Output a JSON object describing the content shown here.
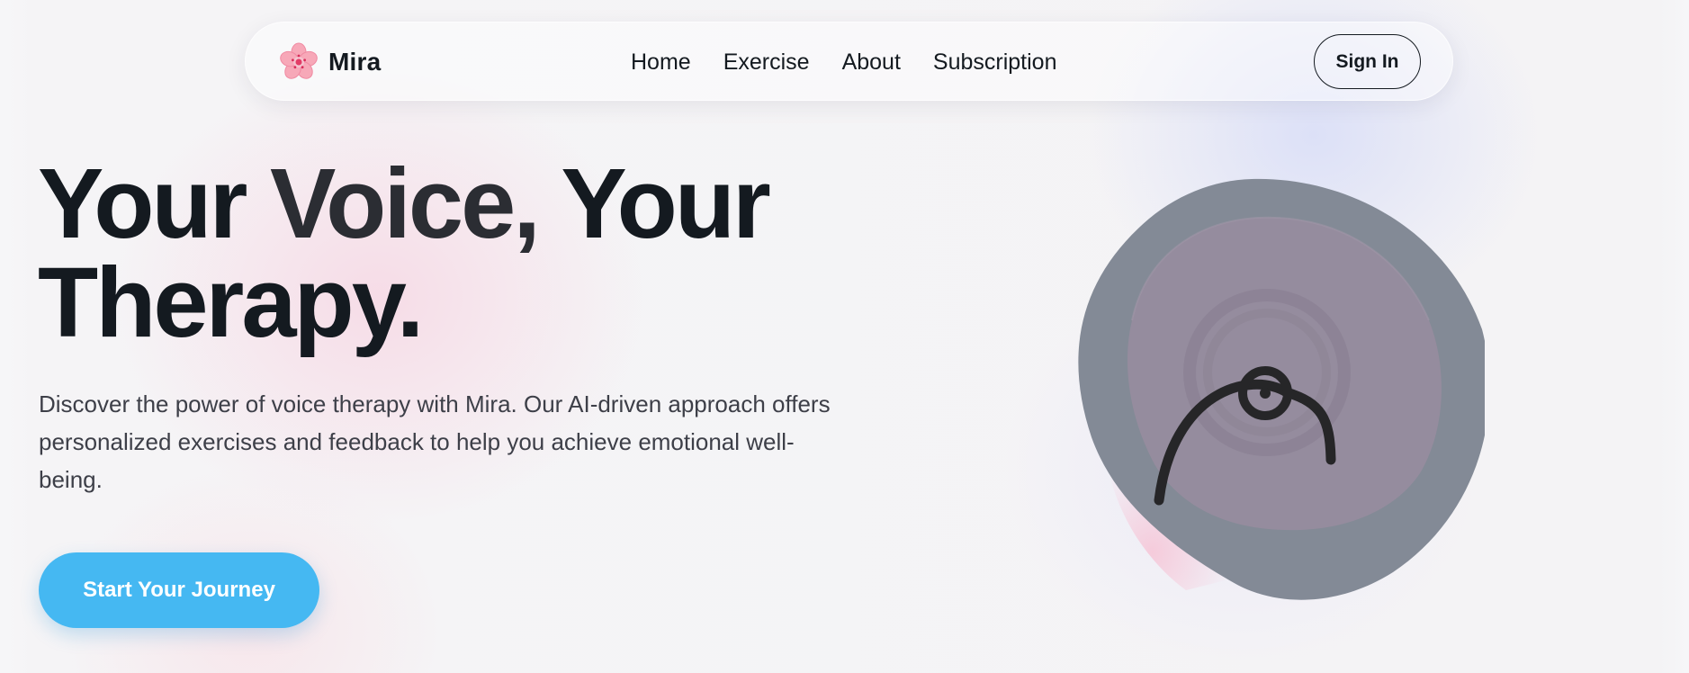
{
  "brand": {
    "name": "Mira",
    "logo_icon": "cherry-blossom-icon"
  },
  "nav": {
    "links": [
      "Home",
      "Exercise",
      "About",
      "Subscription"
    ],
    "sign_in_label": "Sign In"
  },
  "hero": {
    "title_line1_part1": "Your ",
    "title_line1_accent": "Voice,",
    "title_line1_part2": " Your",
    "title_line2": "Therapy.",
    "description": "Discover the power of voice therapy with Mira. Our AI-driven approach offers personalized exercises and feedback to help you achieve emotional well-being.",
    "cta_label": "Start Your Journey",
    "illustration_icon": "voice-wave-icon"
  },
  "colors": {
    "accent": "#45b8f2",
    "text_dark": "#141a20",
    "text_body": "#3d3f48",
    "blob_outer": "#838a96",
    "blob_inner": "#978c9e",
    "logo_petal": "#f7a8b8"
  }
}
